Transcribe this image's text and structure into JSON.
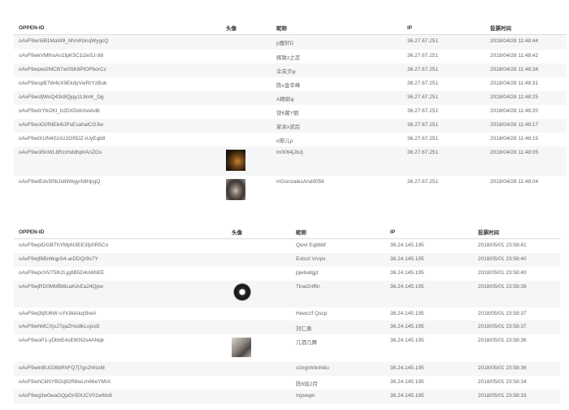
{
  "table1": {
    "headers": {
      "openid": "OPPEN-ID",
      "avatar": "头像",
      "nickname": "昵称",
      "ip": "IP",
      "time": "投票时间"
    },
    "rows": [
      {
        "openid": "oAvF9wn5B1MaW8_MVvKbnqWygcQ",
        "nickname": "p魔轩D",
        "ip": "36.27.67.251",
        "time": "2018/04/28 11:48:44"
      },
      {
        "openid": "oAvF9wkVMfnsAo1fpK5C1i2eSJ-98",
        "nickname": "辉致z之恋",
        "ip": "36.27.67.251",
        "time": "2018/04/28 11:48:42"
      },
      {
        "openid": "oAvF9wpwi2MCB7w0SK8PlOPborCc",
        "nickname": "伞夹贝φ",
        "ip": "36.27.67.251",
        "time": "2018/04/28 11:48:34"
      },
      {
        "openid": "oAvF9wspB7W4cX9EkdyVwRrYzBuk",
        "nickname": "陈x金辛峰",
        "ip": "36.27.67.251",
        "time": "2018/04/28 11:48:31"
      },
      {
        "openid": "oAvF9wsfjWoQ43c8Qjqy1L8mK_Dg",
        "nickname": "A精郎φ",
        "ip": "36.27.67.251",
        "time": "2018/04/28 11:48:25"
      },
      {
        "openid": "oAvF9wtzYbi2Kl_b2DXDvbXelAd8",
        "nickname": "饶6菌Y丽",
        "ip": "36.27.67.251",
        "time": "2018/04/28 11:48:20"
      },
      {
        "openid": "oAvF9woG0fNEb4iJPsEsahalCG3w",
        "nickname": "家余x泥后",
        "ip": "36.27.67.251",
        "time": "2018/04/28 11:48:17"
      },
      {
        "openid": "oAvF9wtXUN4SzXz2GRDZ-iUyEqb8",
        "nickname": "α邪儿ρ",
        "ip": "36.27.67.251",
        "time": "2018/04/28 11:48:15"
      },
      {
        "openid": "oAvF9wol5nWL8RzzhddhplrAnZGs",
        "avatar": "dark-photo-avatar",
        "nickname": "m0064jJbJj",
        "ip": "36.27.67.251",
        "time": "2018/04/28 11:48:05"
      },
      {
        "openid": "oAvF9wtEdv5RbJidNWgyrfdlHpgQ",
        "avatar": "long-hair-photo-avatar",
        "nickname": "mGonzalesAnd0056",
        "ip": "36.27.67.251",
        "time": "2018/04/28 11:48:04"
      }
    ]
  },
  "table2": {
    "headers": {
      "openid": "OPPEN-ID",
      "avatar": "头像",
      "nickname": "昵称",
      "ip": "IP",
      "time": "投票时间"
    },
    "rows": [
      {
        "openid": "oAvF9wpIDGBThYMpN3EE3fp0R5Co",
        "nickname": "Qwvl Eqbbbf",
        "ip": "36.24.145.195",
        "time": "2018/05/01 23:58:41"
      },
      {
        "openid": "oAvF9wjf6Bnl6qpS4-arDDQr9v7Y",
        "nickname": "Eotxzl Vnrpx",
        "ip": "36.24.145.195",
        "time": "2018/05/01 23:58:40"
      },
      {
        "openid": "oAvF9wpcNV75lh2Ljg8B5D4xWbEE",
        "nickname": "pjwlwdgjz",
        "ip": "36.24.145.195",
        "time": "2018/05/01 23:58:40"
      },
      {
        "openid": "oAvF9wjRD0MbfBt8caKlAEa24Qpw",
        "avatar": "circle-avatar",
        "nickname": "TinaGriffin",
        "ip": "36.24.145.195",
        "time": "2018/05/01 23:58:39"
      },
      {
        "openid": "oAvF9wj3tjfU6W-sYk3klAkq5heA",
        "nickname": "Hewczf Qscp",
        "ip": "36.24.145.195",
        "time": "2018/05/01 23:58:37"
      },
      {
        "openid": "oAvF9whMCXjsJ7qaZHxdlkLojxsE",
        "nickname": "刘仁勇",
        "ip": "36.24.145.195",
        "time": "2018/05/01 23:58:37"
      },
      {
        "openid": "oAvF9woP1-yDbhE4sEtKN2s4ANqk",
        "avatar": "photo-avatar",
        "nickname": "几酒几舞",
        "ip": "36.24.145.195",
        "time": "2018/05/01 23:58:36"
      },
      {
        "openid": "oAvF9wlnBU026bRhFQ7j7gx2hNoM",
        "nickname": "cûngnhônhiêu",
        "ip": "36.24.145.195",
        "time": "2018/05/01 23:58:36"
      },
      {
        "openid": "oAvF9whCkNYBOq92R8wLm66eYMIA",
        "nickname": "陈6珑2月",
        "ip": "36.24.145.195",
        "time": "2018/05/01 23:58:34"
      },
      {
        "openid": "oAvF9wg3w0waGQpGn50UCV01wMx8",
        "nickname": "mjoeqel",
        "ip": "36.24.145.195",
        "time": "2018/05/01 23:58:33"
      }
    ]
  }
}
